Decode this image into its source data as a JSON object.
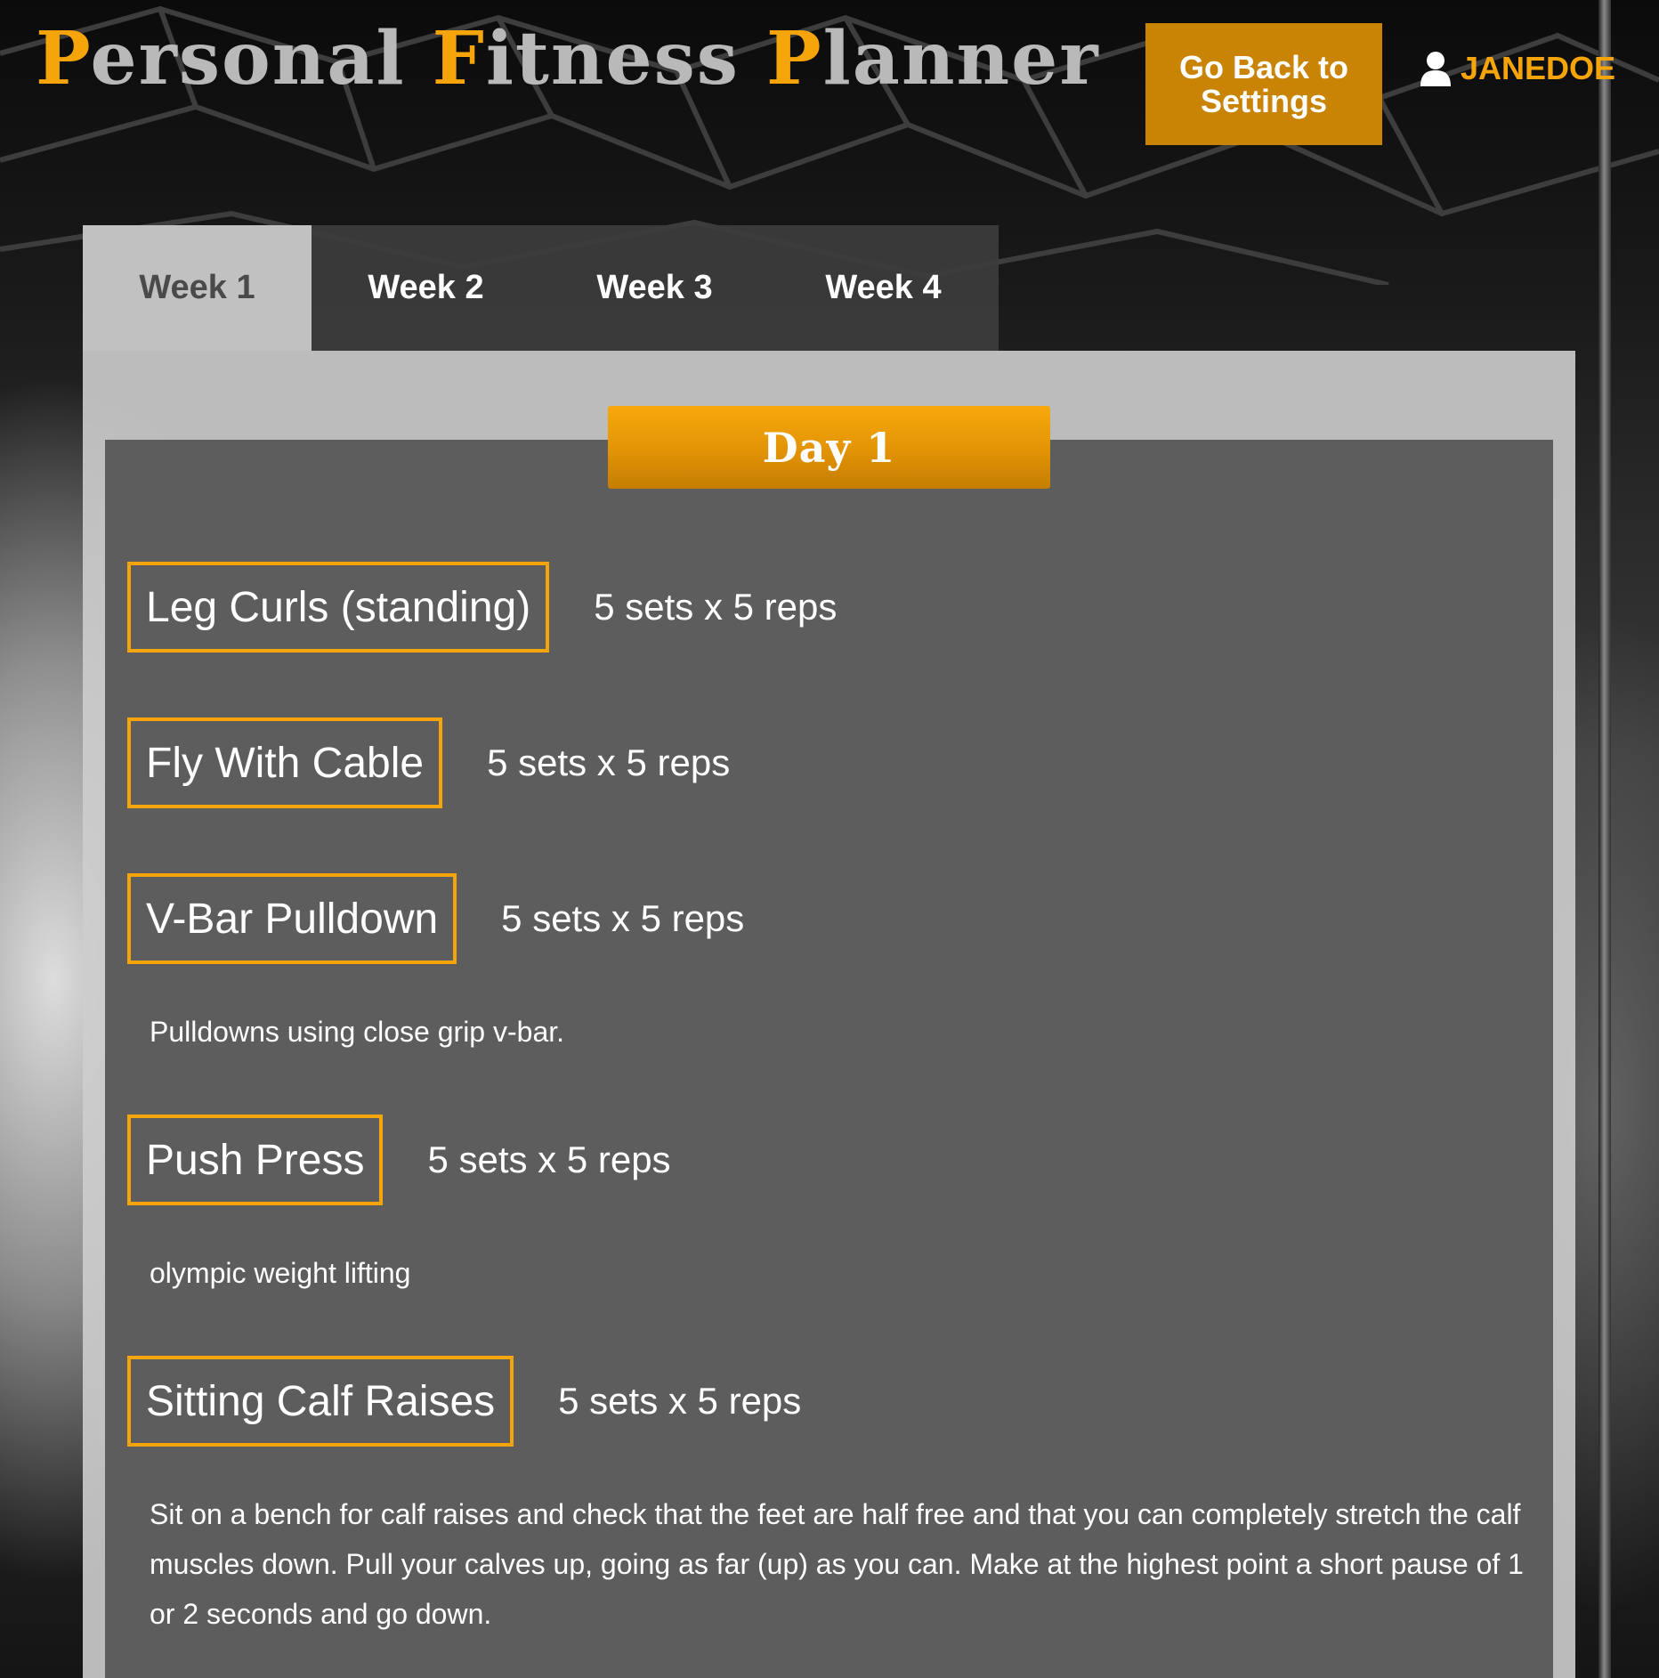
{
  "header": {
    "title_words": [
      {
        "initial": "P",
        "rest": "ersonal"
      },
      {
        "initial": "F",
        "rest": "itness"
      },
      {
        "initial": "P",
        "rest": "lanner"
      }
    ],
    "back_button_label": "Go Back to Settings",
    "username": "JANEDOE",
    "user_icon": "user-icon"
  },
  "tabs": [
    {
      "label": "Week 1",
      "active": true
    },
    {
      "label": "Week 2",
      "active": false
    },
    {
      "label": "Week 3",
      "active": false
    },
    {
      "label": "Week 4",
      "active": false
    }
  ],
  "day": {
    "title": "Day 1",
    "exercises": [
      {
        "name": "Leg Curls (standing)",
        "sets": "5 sets x 5 reps",
        "description": ""
      },
      {
        "name": "Fly With Cable",
        "sets": "5 sets x 5 reps",
        "description": ""
      },
      {
        "name": "V-Bar Pulldown",
        "sets": "5 sets x 5 reps",
        "description": "Pulldowns using close grip v-bar."
      },
      {
        "name": "Push Press",
        "sets": "5 sets x 5 reps",
        "description": "olympic weight lifting"
      },
      {
        "name": "Sitting Calf Raises",
        "sets": "5 sets x 5 reps",
        "description": "Sit on a bench for calf raises and check that the feet are half free and that you can completely stretch the calf muscles down. Pull your calves up, going as far (up) as you can. Make at the highest point a short pause of 1 or 2 seconds and go down."
      }
    ]
  },
  "colors": {
    "accent": "#f5a50a",
    "button": "#c98305",
    "panel": "#585858",
    "tab_bar": "#3c3c3c",
    "tab_active": "#cdcdcd"
  }
}
